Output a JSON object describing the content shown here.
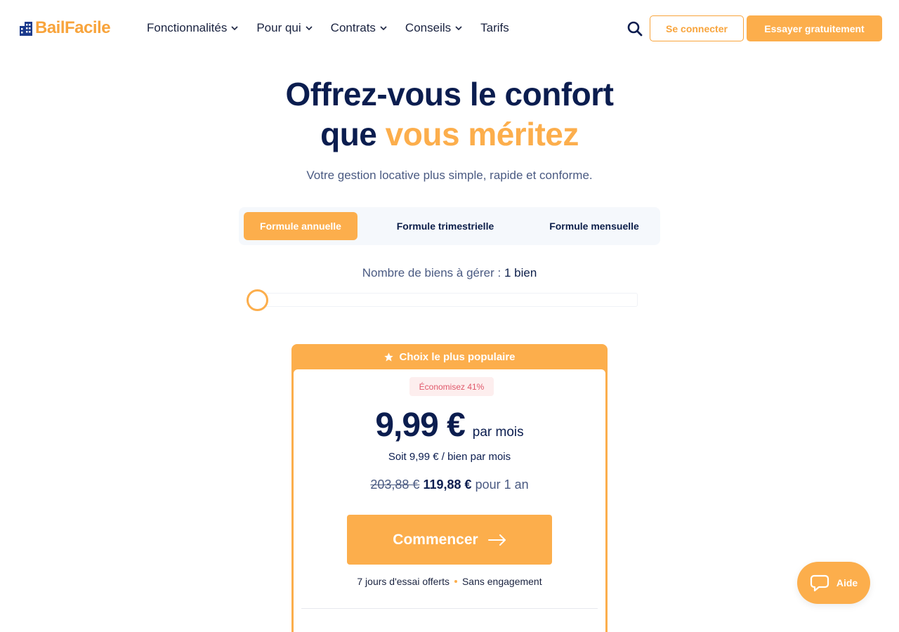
{
  "brand": {
    "name": "BailFacile",
    "accent": "#fcae4c",
    "navy": "#0b1d4f"
  },
  "header": {
    "nav": [
      {
        "label": "Fonctionnalités",
        "has_dropdown": true
      },
      {
        "label": "Pour qui",
        "has_dropdown": true
      },
      {
        "label": "Contrats",
        "has_dropdown": true
      },
      {
        "label": "Conseils",
        "has_dropdown": true
      },
      {
        "label": "Tarifs",
        "has_dropdown": false
      }
    ],
    "search_icon": "search-icon",
    "login_label": "Se connecter",
    "trial_label": "Essayer gratuitement"
  },
  "hero": {
    "title_line1": "Offrez-vous le confort",
    "title_line2_a": "que",
    "title_line2_b": "vous méritez",
    "subtitle": "Votre gestion locative plus simple, rapide et conforme."
  },
  "billing_tabs": [
    {
      "label": "Formule annuelle",
      "active": true
    },
    {
      "label": "Formule trimestrielle",
      "active": false
    },
    {
      "label": "Formule mensuelle",
      "active": false
    }
  ],
  "properties": {
    "label": "Nombre de biens à gérer :",
    "value": "1 bien"
  },
  "plan": {
    "ribbon": "Choix le plus populaire",
    "ribbon_icon": "star-icon",
    "saving": "Économisez 41%",
    "price": "9,99 €",
    "price_unit": "par mois",
    "per_property": "Soit 9,99 € / bien par mois",
    "old_price": "203,88 €",
    "new_price": "119,88 €",
    "period": "pour 1 an",
    "cta": "Commencer",
    "trial": "7 jours d'essai offerts",
    "commitment": "Sans engagement"
  },
  "help": {
    "label": "Aide",
    "icon": "chat-icon"
  }
}
